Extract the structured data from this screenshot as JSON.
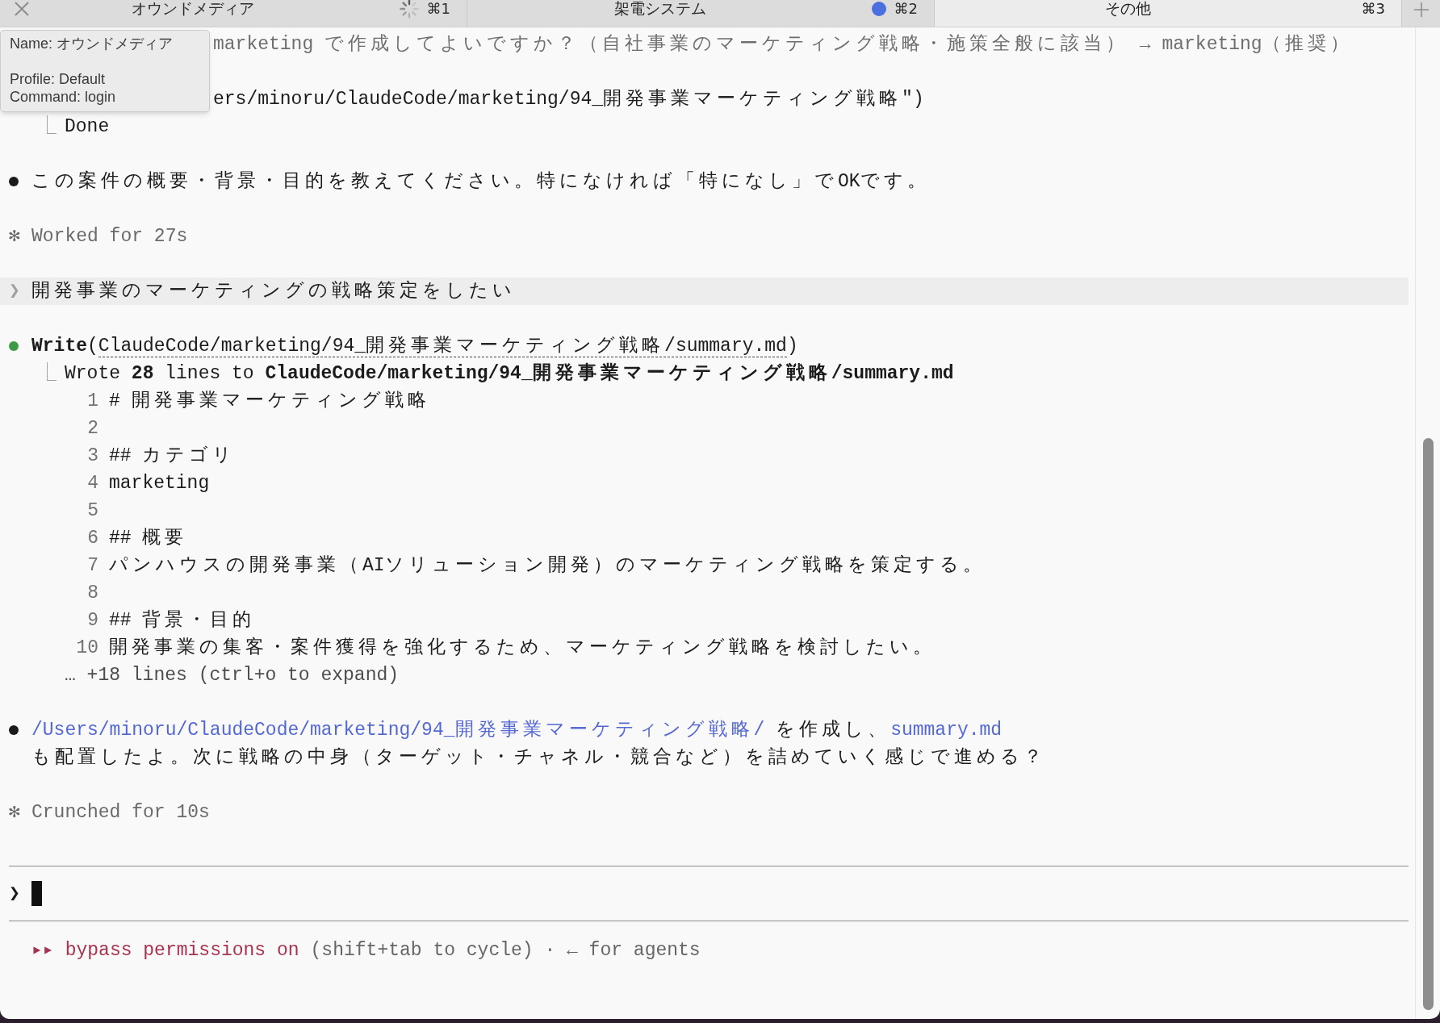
{
  "tabs": [
    {
      "label": "オウンドメディア",
      "shortcut": "⌘1",
      "selected": false,
      "hovered": true,
      "kind": "spinner"
    },
    {
      "label": "架電システム",
      "shortcut": "⌘2",
      "selected": false,
      "hovered": false,
      "kind": "dot"
    },
    {
      "label": "その他",
      "shortcut": "⌘3",
      "selected": true,
      "hovered": false,
      "kind": "plain"
    }
  ],
  "tooltip": {
    "groups": [
      [
        "Name: オウンドメディア"
      ],
      [
        "Profile: Default",
        "Command: login"
      ]
    ]
  },
  "transcript": [
    {
      "kind": "faded_text",
      "covered": true,
      "text": "marketing で作成してよいですか？（自社事業のマーケティング戦略・施策全般に該当） → marketing（推奨）"
    },
    {
      "kind": "plain",
      "covered": true,
      "text": "ers/minoru/ClaudeCode/marketing/94_開発事業マーケティング戦略\")"
    },
    {
      "kind": "result",
      "connector": "⎿",
      "text": "Done"
    },
    {
      "kind": "message",
      "color": "#1a1a1a",
      "segments": [
        {
          "kind": "text",
          "text": "この案件の概要・背景・目的を教えてください。特になければ「特になし」でOKです。"
        }
      ]
    },
    {
      "kind": "status",
      "symbol": "✻",
      "text": "Worked for 27s"
    },
    {
      "kind": "user_prompt",
      "symbol": "❯",
      "text": "開発事業のマーケティングの戦略策定をしたい"
    },
    {
      "kind": "tool_call",
      "color": "#3f9a48",
      "before": "**Write**(",
      "link": "ClaudeCode/marketing/94_開発事業マーケティング戦略/summary.md",
      "after": ")"
    },
    {
      "kind": "result",
      "connector": "⎿",
      "text": "Wrote **28** lines to **ClaudeCode/marketing/94_開発事業マーケティング戦略/summary.md**"
    },
    {
      "kind": "file_preview",
      "lines": [
        {
          "number": "1",
          "text": "# 開発事業マーケティング戦略"
        },
        {
          "number": "2"
        },
        {
          "number": "3",
          "text": "## カテゴリ"
        },
        {
          "number": "4",
          "text": "marketing"
        },
        {
          "number": "5"
        },
        {
          "number": "6",
          "text": "## 概要"
        },
        {
          "number": "7",
          "text": "パンハウスの開発事業（AIソリューション開発）のマーケティング戦略を策定する。"
        },
        {
          "number": "8"
        },
        {
          "number": "9",
          "text": "## 背景・目的"
        },
        {
          "number": "10",
          "text": "開発事業の集客・案件獲得を強化するため、マーケティング戦略を検討したい。"
        }
      ]
    },
    {
      "kind": "more",
      "text": "… +18 lines (ctrl+o to expand)"
    },
    {
      "kind": "message",
      "color": "#1a1a1a",
      "segments": [
        {
          "kind": "link",
          "text": "/Users/minoru/ClaudeCode/marketing/94_開発事業マーケティング戦略/"
        },
        {
          "kind": "text",
          "text": " を作成し、"
        },
        {
          "kind": "link",
          "text": "summary.md"
        },
        {
          "kind": "break"
        },
        {
          "kind": "text",
          "text": "も配置したよ。次に戦略の中身（ターゲット・チャネル・競合など）を詰めていく感じで進める？"
        }
      ]
    },
    {
      "kind": "status",
      "symbol": "✻",
      "text": "Crunched for 10s"
    }
  ],
  "prompt": {
    "symbol": "❯"
  },
  "status_line": {
    "symbol": "▸▸",
    "mode": "bypass permissions on",
    "hint": "(shift+tab to cycle) · ← for agents"
  }
}
